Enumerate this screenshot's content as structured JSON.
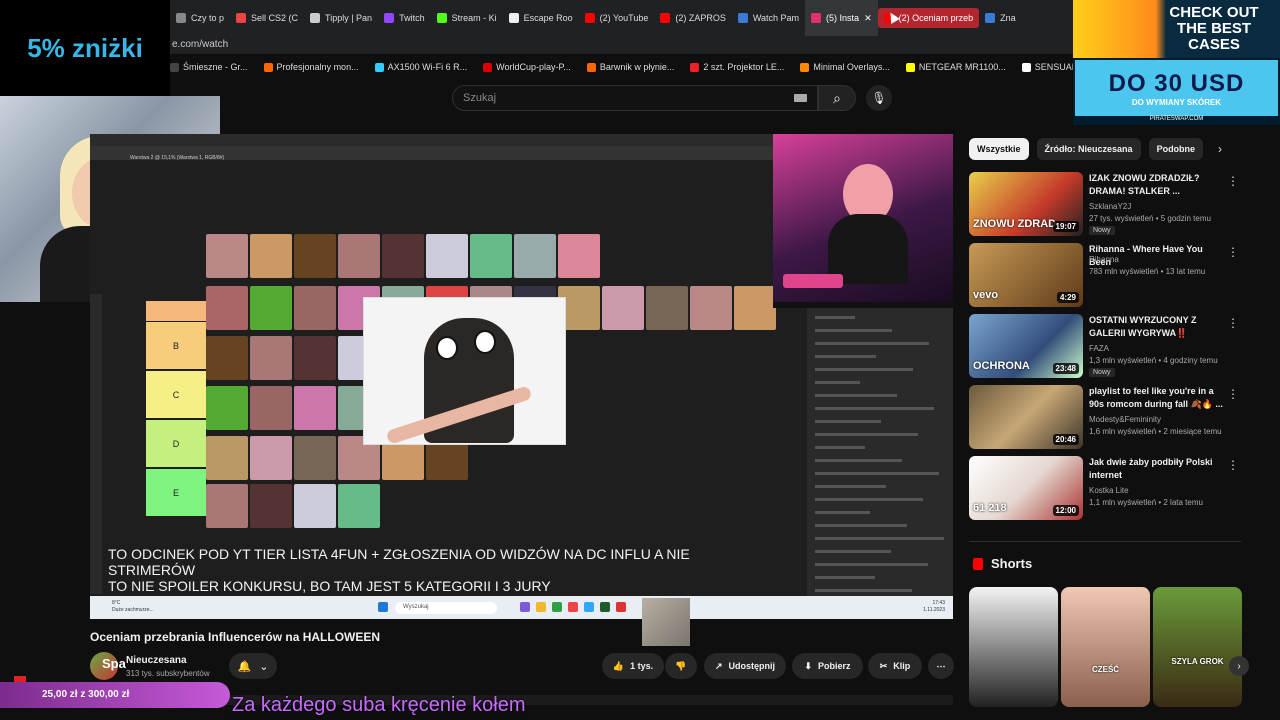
{
  "promo": {
    "text": "5% zniżki"
  },
  "tabs": [
    {
      "label": "Czy to p",
      "color": "#888"
    },
    {
      "label": "Sell CS2 (C",
      "color": "#e44"
    },
    {
      "label": "Tipply | Pan",
      "color": "#ccc"
    },
    {
      "label": "Twitch",
      "color": "#9146ff"
    },
    {
      "label": "Stream - Ki",
      "color": "#53fc18"
    },
    {
      "label": "Escape Roo",
      "color": "#eee"
    },
    {
      "label": "(2) YouTube",
      "color": "#f00"
    },
    {
      "label": "(2) ZAPROS",
      "color": "#f00"
    },
    {
      "label": "Watch Pam",
      "color": "#3a7bd5"
    },
    {
      "label": "(5) Insta",
      "color": "#e1306c"
    },
    {
      "label": "(2) Oceniam przeb",
      "color": "#f00"
    },
    {
      "label": "Zna",
      "color": "#3a7bd5"
    }
  ],
  "address": "e.com/watch",
  "bookmarks": [
    {
      "label": "Śmieszne - Gr...",
      "color": "#444"
    },
    {
      "label": "Profesjonalny mon...",
      "color": "#f60"
    },
    {
      "label": "AX1500 Wi-Fi 6 R...",
      "color": "#3cf"
    },
    {
      "label": "WorldCup-play-P...",
      "color": "#d00"
    },
    {
      "label": "Barwnik w płynie...",
      "color": "#f60"
    },
    {
      "label": "2 szt. Projektor LE...",
      "color": "#e22"
    },
    {
      "label": "Minimal Overlays...",
      "color": "#f80"
    },
    {
      "label": "NETGEAR MR1100...",
      "color": "#ff0"
    },
    {
      "label": "SENSUAL VANILL...",
      "color": "#fff"
    }
  ],
  "ad": {
    "line1": "CHECK OUT THE BEST CASES",
    "line2": "DO 30 USD",
    "line3": "DO WYMIANY SKÓREK",
    "line4": "PIRATESWAP.COM"
  },
  "search": {
    "placeholder": "Szukaj"
  },
  "icons": {
    "search": "search-icon",
    "mic": "mic-icon",
    "bell": "bell-icon"
  },
  "video": {
    "ps_title": "Warstwa 2 @ 15,1% (Warstwa 1, RGB/8#)",
    "tiers": [
      "B",
      "C",
      "D",
      "E"
    ],
    "caption_line1": "TO ODCINEK POD YT TIER LISTA 4FUN + ZGŁOSZENIA OD WIDZÓW NA DC INFLU A NIE STRIMERÓW",
    "caption_line2": "TO NIE SPOILER KONKURSU, BO TAM JEST 5 KATEGORII I 3 JURY",
    "taskbar_search": "Wyszukaj",
    "taskbar_time": "17:43",
    "taskbar_date": "1.11.2023",
    "weather_temp": "8°C",
    "weather_text": "Duże zachmurze..."
  },
  "title": "Oceniam przebrania Influencerów na HALLOWEEN",
  "channel": {
    "avatar_text": "Spa",
    "name": "Nieuczesana",
    "subs": "313 tys. subskrybentów"
  },
  "actions": {
    "likes": "1 tys.",
    "share": "Udostępnij",
    "download": "Pobierz",
    "clip": "Klip"
  },
  "chips": [
    "Wszystkie",
    "Źródło: Nieuczesana",
    "Podobne"
  ],
  "recommendations": [
    {
      "title": "IZAK ZNOWU ZDRADZIŁ? DRAMA! STALKER ...",
      "channel": "SzklanaY2J",
      "meta": "27 tys. wyświetleń • 5 godzin temu",
      "badge": "Nowy",
      "duration": "19:07",
      "thumb_text": "ZNOWU ZDRAD"
    },
    {
      "title": "Rihanna - Where Have You Been",
      "channel": "Rihanna",
      "meta": "783 mln wyświetleń • 13 lat temu",
      "badge": "",
      "duration": "4:29",
      "thumb_text": "vevo"
    },
    {
      "title": "OSTATNI WYRZUCONY Z GALERII WYGRYWA‼️",
      "channel": "FAZA",
      "meta": "1,3 mln wyświetleń • 4 godziny temu",
      "badge": "Nowy",
      "duration": "23:48",
      "thumb_text": "OCHRONA"
    },
    {
      "title": "playlist to feel like you're in a 90s romcom during fall 🍂🔥 ...",
      "channel": "Modesty&Femininity",
      "meta": "1,6 mln wyświetleń • 2 miesiące temu",
      "badge": "",
      "duration": "20:46",
      "thumb_text": ""
    },
    {
      "title": "Jak dwie żaby podbiły Polski internet",
      "channel": "Kostka Lite",
      "meta": "1,1 mln wyświetleń • 2 lata temu",
      "badge": "",
      "duration": "12:00",
      "thumb_text": "61 218"
    }
  ],
  "shorts": {
    "header": "Shorts",
    "items": [
      {
        "label": "",
        "color1": "#f3f3f3",
        "color2": "#222"
      },
      {
        "label": "CZEŚĆ",
        "color1": "#f0c8b4",
        "color2": "#8a5f4b"
      },
      {
        "label": "SZYLA GROK",
        "color1": "#6a9b3a",
        "color2": "#3b2a14"
      }
    ]
  },
  "donation": {
    "text": "25,00 zł z 300,00 zł",
    "progress": 0.083
  },
  "subtitle": "Za każdego suba kręcenie kołem"
}
